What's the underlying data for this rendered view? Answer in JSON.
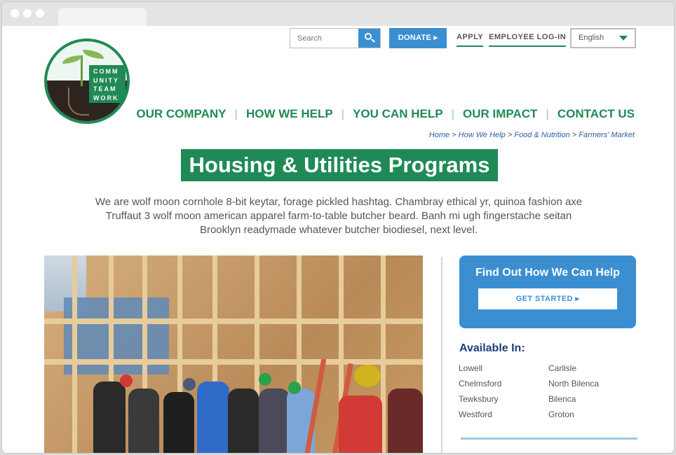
{
  "logo": {
    "lines": [
      "COMM",
      "UNITY",
      "TEAM",
      "WORK"
    ]
  },
  "header": {
    "search_placeholder": "Search",
    "donate_label": "DONATE ▸",
    "apply_label": "APPLY",
    "employee_login_label": "EMPLOYEE LOG-IN",
    "language": "English"
  },
  "nav": {
    "items": [
      "OUR COMPANY",
      "HOW WE HELP",
      "YOU CAN HELP",
      "OUR IMPACT",
      "CONTACT US"
    ]
  },
  "breadcrumb": [
    "Home",
    "How We Help",
    "Food & Nutrition",
    "Farmers' Market"
  ],
  "page": {
    "title": "Housing & Utilities Programs",
    "intro": "We are wolf moon cornhole 8-bit keytar, forage pickled hashtag. Chambray ethical yr, quinoa fashion axe Truffaut 3 wolf moon american apparel farm-to-table butcher beard. Banh mi ugh fingerstache seitan Brooklyn readymade whatever butcher biodiesel, next level."
  },
  "sidebar": {
    "help_heading": "Find Out How We Can Help",
    "get_started_label": "GET STARTED ▸",
    "available_heading": "Available In:",
    "towns": [
      "Lowell",
      "Carlisle",
      "Chelmsford",
      "North Bilenca",
      "Tewksbury",
      "Bilenca",
      "Westford",
      "Groton"
    ]
  },
  "colors": {
    "green": "#1f8a56",
    "blue": "#3b8fd1",
    "navy": "#1d3f7a"
  }
}
